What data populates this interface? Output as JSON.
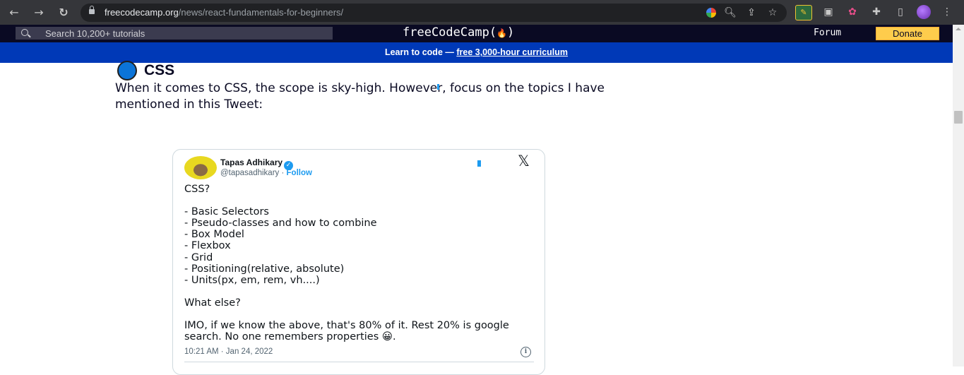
{
  "browser": {
    "url_host": "freecodecamp.org",
    "url_path": "/news/react-fundamentals-for-beginners/",
    "nav_icons": [
      "back-arrow-icon",
      "forward-arrow-icon",
      "reload-icon"
    ],
    "omnibox_icons": [
      "google-icon",
      "zoom-icon",
      "share-icon",
      "star-icon"
    ],
    "extension_icons": [
      "extension-a-icon",
      "tab-search-icon",
      "color-picker-icon",
      "puzzle-icon",
      "side-panel-icon",
      "profile-avatar-icon",
      "more-menu-icon"
    ]
  },
  "site": {
    "search_placeholder": "Search 10,200+ tutorials",
    "logo_text": "freeCodeCamp(",
    "logo_flame": "🔥",
    "logo_close": ")",
    "forum_label": "Forum",
    "donate_label": "Donate",
    "banner_text": "Learn to code — ",
    "banner_link": "free 3,000-hour curriculum",
    "colors": {
      "nav_bg": "#0a0a23",
      "banner_bg": "#0039b7",
      "donate_bg": "#fecc4c"
    }
  },
  "article": {
    "heading": "CSS",
    "paragraph": "When it comes to CSS, the scope is sky-high. However, focus on the topics I have mentioned in this Tweet:"
  },
  "tweet": {
    "author_name": "Tapas Adhikary",
    "handle": "@tapasadhikary",
    "separator": " · ",
    "follow_label": "Follow",
    "body": "CSS?\n\n- Basic Selectors\n- Pseudo-classes and how to combine\n- Box Model\n- Flexbox\n- Grid\n- Positioning(relative, absolute)\n- Units(px, em, rem, vh....)\n\nWhat else?\n\nIMO, if we know the above, that's 80% of it. Rest 20% is google search. No one remembers properties 😀.",
    "timestamp": "10:21 AM · Jan 24, 2022"
  }
}
